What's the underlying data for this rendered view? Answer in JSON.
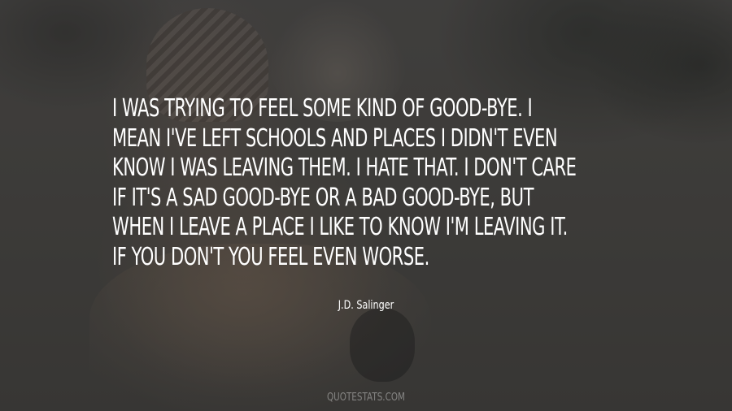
{
  "quote": {
    "lines": [
      "I was trying to feel some kind of good-bye. I",
      "mean I've left schools and places I didn't even",
      "know I was leaving them. I hate that. I don't care",
      "if it's a sad good-bye or a bad good-bye, but",
      "when I leave a place I like to know I'm leaving it.",
      "If you don't you feel even worse."
    ]
  },
  "author": "J.D. Salinger",
  "watermark": "QUOTESTATS.COM",
  "colors": {
    "text": "#ffffff",
    "overlay": "#141414"
  }
}
